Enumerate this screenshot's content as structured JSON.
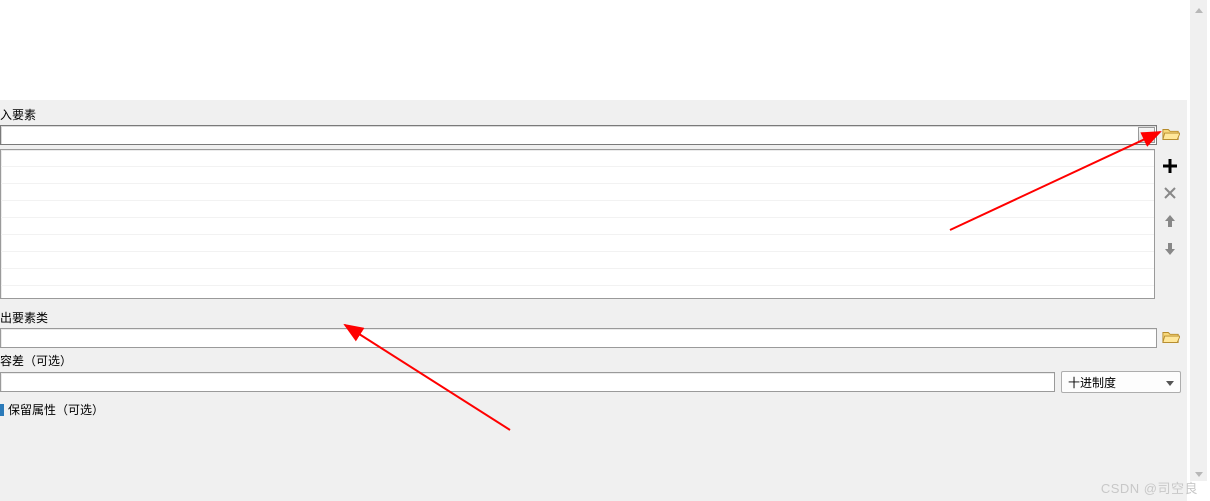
{
  "labels": {
    "input_features": "入要素",
    "output_fc": "出要素类",
    "tolerance": "容差（可选）",
    "preserve_attrs": "保留属性（可选）"
  },
  "tolerance_unit": {
    "selected": "十进制度"
  },
  "icons": {
    "folder": "folder-open-icon",
    "add": "plus-icon",
    "remove": "x-icon",
    "move_up": "arrow-up-icon",
    "move_down": "arrow-down-icon",
    "dropdown": "chevron-down-icon",
    "scroll_up": "chevron-up-icon",
    "scroll_down": "chevron-down-icon"
  },
  "watermark": "CSDN @司空良"
}
